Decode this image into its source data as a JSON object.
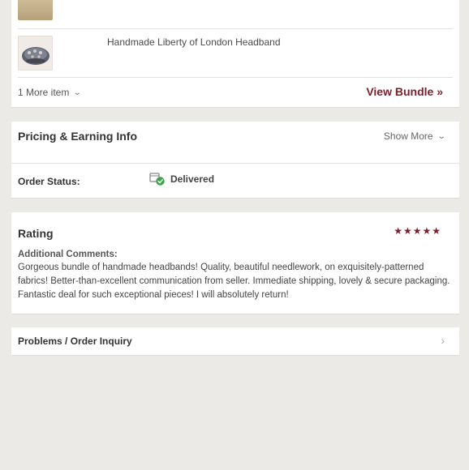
{
  "items": {
    "list": [
      {
        "title": "",
        "image": "bundle-item-thumbnail"
      },
      {
        "title": "Handmade Liberty of London Headband",
        "image": "headband-thumbnail"
      }
    ],
    "more_items_label": "1 More item",
    "view_bundle_label": "View Bundle »"
  },
  "pricing": {
    "title": "Pricing & Earning Info",
    "show_more_label": "Show More",
    "order_status_label": "Order Status:",
    "order_status_value": "Delivered",
    "status_color": "#3aa34a"
  },
  "rating": {
    "title": "Rating",
    "stars": "★★★★★",
    "star_count": 5,
    "comments_label": "Additional Comments:",
    "comments_text": "Gorgeous bundle of handmade headbands! Quality, beautiful needlework, on exquisitely-patterned fabrics! Better-than-excellent communication from seller. Immediate shipping, lovely & secure packaging. Fantastic deal for such exceptional pieces! I will absolutely return!"
  },
  "problems": {
    "label": "Problems / Order Inquiry"
  },
  "colors": {
    "accent": "#7a1e2a",
    "background": "#eceae6",
    "card": "#ffffff"
  }
}
